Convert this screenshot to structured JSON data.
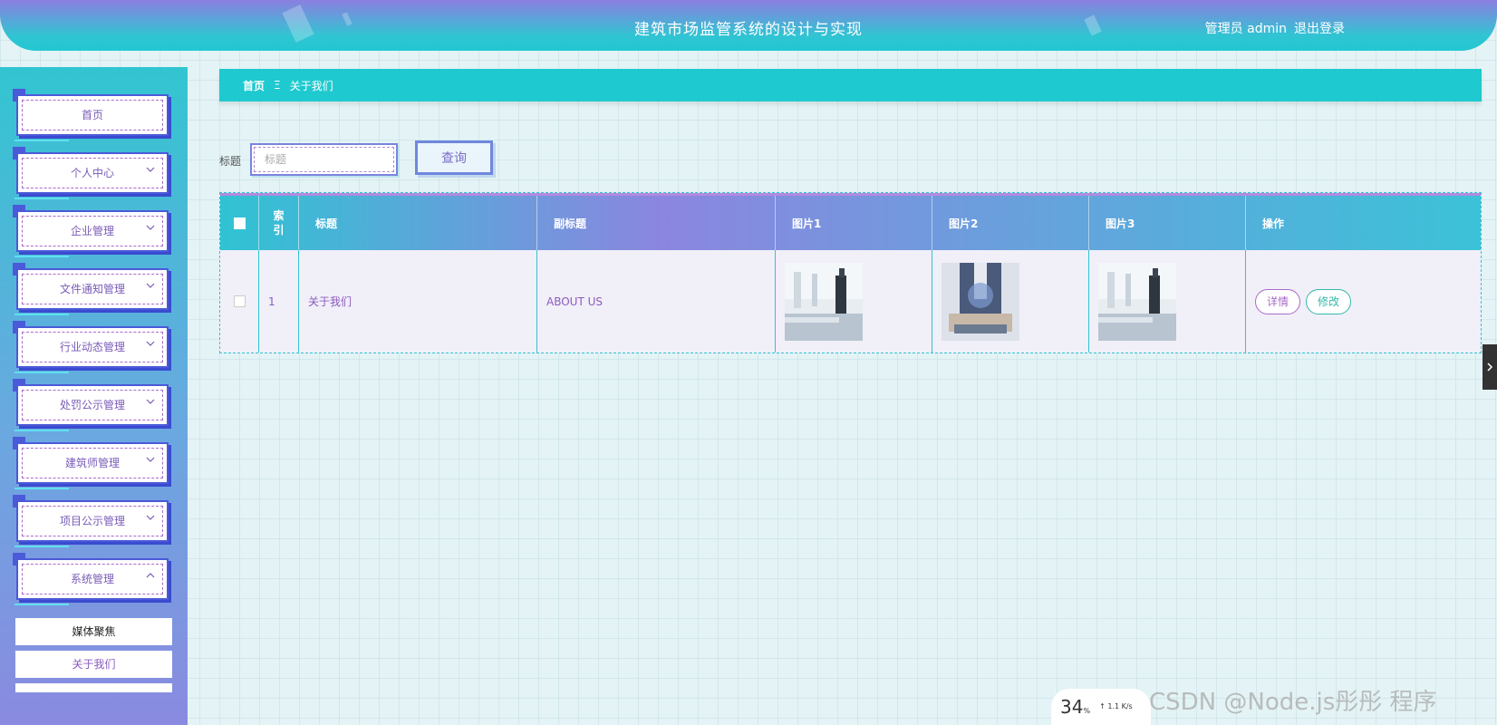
{
  "header": {
    "title": "建筑市场监管系统的设计与实现",
    "user": "管理员 admin",
    "logout": "退出登录"
  },
  "sidebar": {
    "items": [
      {
        "label": "首页",
        "icon": "none"
      },
      {
        "label": "个人中心",
        "icon": "chevron-down-icon"
      },
      {
        "label": "企业管理",
        "icon": "chevron-down-icon"
      },
      {
        "label": "文件通知管理",
        "icon": "chevron-down-icon"
      },
      {
        "label": "行业动态管理",
        "icon": "chevron-down-icon"
      },
      {
        "label": "处罚公示管理",
        "icon": "chevron-down-icon"
      },
      {
        "label": "建筑师管理",
        "icon": "chevron-down-icon"
      },
      {
        "label": "项目公示管理",
        "icon": "chevron-down-icon"
      },
      {
        "label": "系统管理",
        "icon": "chevron-up-icon"
      }
    ],
    "submenu": [
      {
        "label": "媒体聚焦"
      },
      {
        "label": "关于我们"
      }
    ]
  },
  "breadcrumb": {
    "home": "首页",
    "separator": "Ξ",
    "current": "关于我们"
  },
  "search": {
    "label": "标题",
    "placeholder": "标题",
    "button": "查询"
  },
  "table": {
    "headers": [
      "索引",
      "标题",
      "副标题",
      "图片1",
      "图片2",
      "图片3",
      "操作"
    ],
    "rows": [
      {
        "index": "1",
        "title": "关于我们",
        "subtitle": "ABOUT US",
        "detail_btn": "详情",
        "edit_btn": "修改"
      }
    ]
  },
  "overlay": {
    "percent": "34",
    "percent_unit": "%",
    "upload_rate": "1.1 K/s",
    "watermark": "CSDN @Node.js彤彤  程序"
  },
  "colors": {
    "accent": "#1ec9cf",
    "purple": "#8b7fe0",
    "frame": "#4b5ad8"
  }
}
